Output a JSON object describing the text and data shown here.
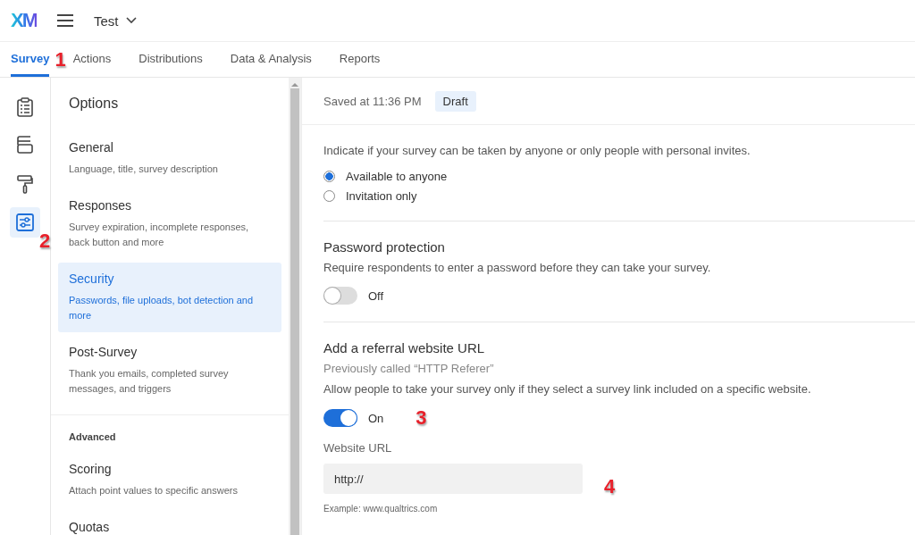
{
  "header": {
    "logo": "XM",
    "project": "Test"
  },
  "tabs": [
    {
      "label": "Survey",
      "selected": true
    },
    {
      "label": "Actions",
      "selected": false
    },
    {
      "label": "Distributions",
      "selected": false
    },
    {
      "label": "Data & Analysis",
      "selected": false
    },
    {
      "label": "Reports",
      "selected": false
    }
  ],
  "rail": [
    {
      "kind": "clipboard",
      "selected": false
    },
    {
      "kind": "blocks",
      "selected": false
    },
    {
      "kind": "roller",
      "selected": false
    },
    {
      "kind": "sliders",
      "selected": true
    }
  ],
  "options": {
    "title": "Options",
    "items": [
      {
        "title": "General",
        "description": "Language, title, survey description",
        "selected": false
      },
      {
        "title": "Responses",
        "description": "Survey expiration, incomplete responses, back button and more",
        "selected": false
      },
      {
        "title": "Security",
        "description": "Passwords, file uploads, bot detection and more",
        "selected": true
      },
      {
        "title": "Post-Survey",
        "description": "Thank you emails, completed survey messages, and triggers",
        "selected": false
      }
    ],
    "advanced_heading": "Advanced",
    "advanced_items": [
      {
        "title": "Scoring",
        "description": "Attach point values to specific answers",
        "selected": false
      },
      {
        "title": "Quotas",
        "selected": false
      }
    ]
  },
  "status": {
    "saved": "Saved at 11:36 PM",
    "badge": "Draft"
  },
  "access": {
    "description": "Indicate if your survey can be taken by anyone or only people with personal invites.",
    "radios": [
      {
        "label": "Available to anyone",
        "selected": true
      },
      {
        "label": "Invitation only",
        "selected": false
      }
    ]
  },
  "password": {
    "title": "Password protection",
    "description": "Require respondents to enter a password before they can take your survey.",
    "on": false,
    "state_label": "Off"
  },
  "referral": {
    "title": "Add a referral website URL",
    "note": "Previously called “HTTP Referer”",
    "description": "Allow people to take your survey only if they select a survey link included on a specific website.",
    "on": true,
    "state_label": "On",
    "field_label": "Website URL",
    "field_value": "http://",
    "example": "Example: www.qualtrics.com"
  },
  "callouts": [
    "1",
    "2",
    "3",
    "4"
  ]
}
